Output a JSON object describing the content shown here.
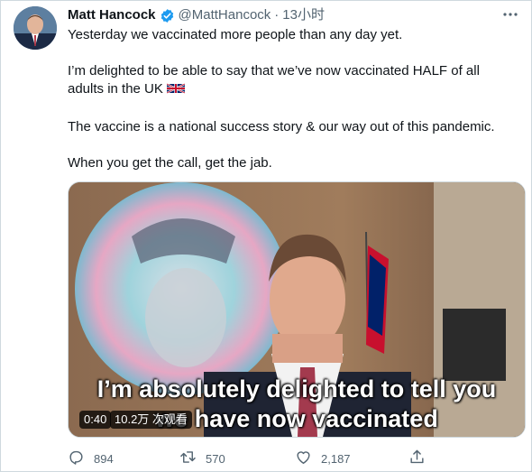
{
  "tweet": {
    "author_name": "Matt Hancock",
    "handle": "@MattHancock",
    "separator": "·",
    "time": "13小时",
    "paragraphs": [
      "Yesterday we vaccinated more people than any day yet.",
      "I’m delighted to be able to say that we’ve now vaccinated HALF of all adults in the UK",
      "The vaccine is a national success story & our way out of this pandemic.",
      "When you get the call, get the jab."
    ]
  },
  "media": {
    "subtitle_line1": "I’m absolutely delighted to tell you",
    "subtitle_line2": "we have now vaccinated",
    "duration": "0:40",
    "views": "10.2万 次观看"
  },
  "actions": {
    "reply_count": "894",
    "retweet_count": "570",
    "like_count": "2,187"
  },
  "icons": [
    "verified-badge-icon",
    "more-options-icon",
    "uk-flag-icon",
    "reply-icon",
    "retweet-icon",
    "like-icon",
    "share-icon"
  ],
  "colors": {
    "text": "#0f1419",
    "secondary": "#536471",
    "verified": "#1d9bf0",
    "border": "#cfd9de"
  }
}
